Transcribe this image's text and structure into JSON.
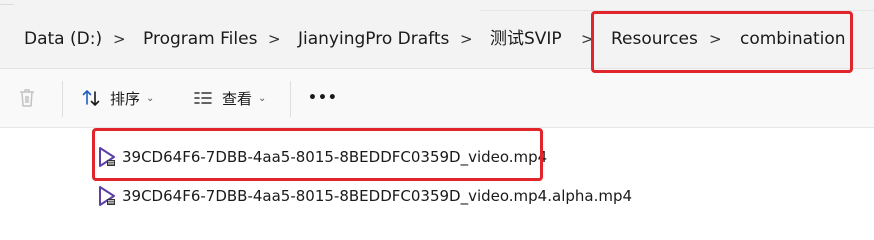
{
  "breadcrumb": {
    "items": [
      "Data (D:)",
      "Program Files",
      "JianyingPro Drafts",
      "测试SVIP",
      "Resources",
      "combination"
    ],
    "separator": ">"
  },
  "toolbar": {
    "sort_label": "排序",
    "view_label": "查看",
    "more_label": "•••"
  },
  "files": [
    {
      "name": "39CD64F6-7DBB-4aa5-8015-8BEDDFC0359D_video.mp4",
      "icon": "video-file-icon"
    },
    {
      "name": "39CD64F6-7DBB-4aa5-8015-8BEDDFC0359D_video.mp4.alpha.mp4",
      "icon": "video-file-icon"
    }
  ],
  "colors": {
    "highlight": "#e0262b",
    "icon_accent": "#5b3fa6",
    "toolbar_icon": "#1f5fbf"
  }
}
